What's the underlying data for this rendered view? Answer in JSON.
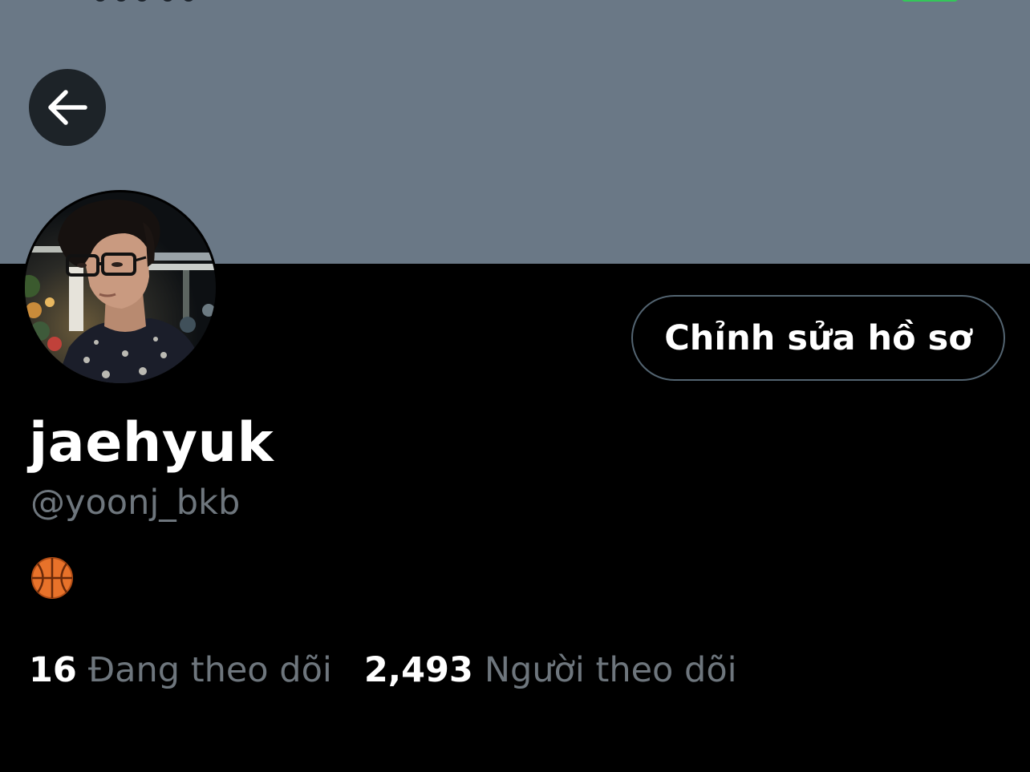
{
  "profile": {
    "display_name": "jaehyuk",
    "handle": "@yoonj_bkb",
    "bio_icon": "basketball-emoji",
    "edit_button_label": "Chỉnh sửa hồ sơ"
  },
  "stats": {
    "following_count": "16",
    "following_label": "Đang theo dõi",
    "followers_count": "2,493",
    "followers_label": "Người theo dõi"
  },
  "icons": {
    "back": "arrow-left-icon",
    "bio": "basketball-icon"
  },
  "colors": {
    "banner": "#6a7886",
    "background": "#000000",
    "primary_text": "#ffffff",
    "secondary_text": "#6e767d",
    "button_border": "#536471",
    "back_button_bg": "#1d2328"
  }
}
